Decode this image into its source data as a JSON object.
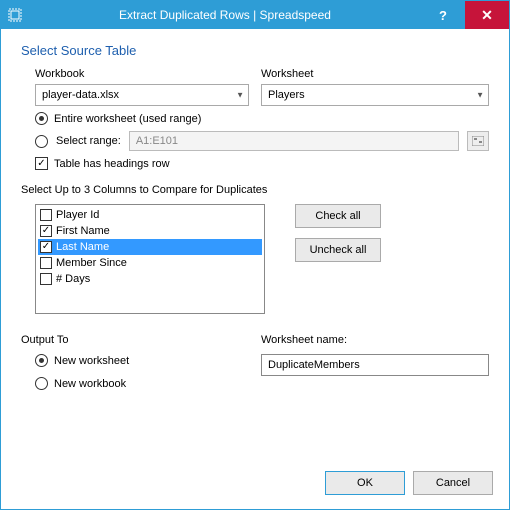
{
  "titlebar": {
    "title": "Extract Duplicated Rows  |  Spreadspeed",
    "help": "?",
    "close": "✕"
  },
  "source": {
    "heading": "Select Source Table",
    "workbook_label": "Workbook",
    "workbook_value": "player-data.xlsx",
    "worksheet_label": "Worksheet",
    "worksheet_value": "Players",
    "entire_label": "Entire worksheet (used range)",
    "range_label": "Select range:",
    "range_value": "A1:E101",
    "headings_label": "Table has headings row"
  },
  "columns": {
    "heading": "Select Up to 3 Columns to Compare for Duplicates",
    "items": [
      {
        "label": "Player Id",
        "checked": false,
        "selected": false
      },
      {
        "label": "First Name",
        "checked": true,
        "selected": false
      },
      {
        "label": "Last Name",
        "checked": true,
        "selected": true
      },
      {
        "label": "Member Since",
        "checked": false,
        "selected": false
      },
      {
        "label": "# Days",
        "checked": false,
        "selected": false
      }
    ],
    "check_all": "Check all",
    "uncheck_all": "Uncheck all"
  },
  "output": {
    "heading": "Output To",
    "new_worksheet": "New worksheet",
    "new_workbook": "New workbook",
    "name_label": "Worksheet name:",
    "name_value": "DuplicateMembers"
  },
  "footer": {
    "ok": "OK",
    "cancel": "Cancel"
  }
}
